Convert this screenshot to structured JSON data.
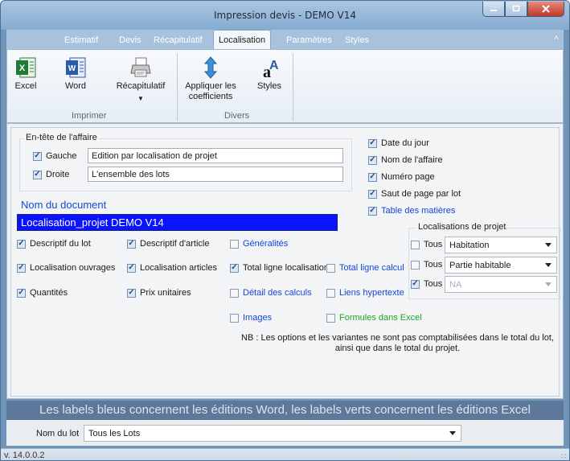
{
  "window": {
    "title": "Impression devis  - DEMO V14",
    "controls": {
      "minimize_icon": "minimize-icon",
      "maximize_icon": "maximize-icon",
      "close_icon": "close-icon"
    }
  },
  "tabs": [
    {
      "label": "Estimatif"
    },
    {
      "label": "Devis"
    },
    {
      "label": "Récapitulatif"
    },
    {
      "label": "Localisation",
      "active": true
    },
    {
      "label": "Paramètres"
    },
    {
      "label": "Styles"
    }
  ],
  "ribbon": {
    "excel_label": "Excel",
    "word_label": "Word",
    "recap_label": "Récapitulatif",
    "appliquer_label_1": "Appliquer les",
    "appliquer_label_2": "coefficients",
    "styles_label": "Styles",
    "group_imprimer": "Imprimer",
    "group_divers": "Divers"
  },
  "entete": {
    "title": "En-tête de l'affaire",
    "gauche_label": "Gauche",
    "gauche_checked": true,
    "gauche_value": "Edition par localisation de projet",
    "droite_label": "Droite",
    "droite_checked": true,
    "droite_value": "L'ensemble des lots"
  },
  "right_options": [
    {
      "label": "Date du jour",
      "checked": true
    },
    {
      "label": "Nom de l'affaire",
      "checked": true
    },
    {
      "label": "Numéro page",
      "checked": true
    },
    {
      "label": "Saut de page par lot",
      "checked": true
    },
    {
      "label": "Table des matières",
      "checked": true,
      "color": "blue"
    }
  ],
  "document": {
    "label": "Nom du document",
    "value": "Localisation_projet DEMO V14"
  },
  "options": {
    "descriptif_lot": "Descriptif du lot",
    "localisation_ouvrages": "Localisation ouvrages",
    "quantites": "Quantités",
    "descriptif_article": "Descriptif d'article",
    "localisation_articles": "Localisation articles",
    "prix_unitaires": "Prix unitaires",
    "generalites": "Généralités",
    "total_ligne_localisation": "Total ligne localisation",
    "total_ligne_calcul": "Total ligne calcul",
    "detail_calculs": "Détail des calculs",
    "liens_hypertexte": "Liens hypertexte",
    "images": "Images",
    "formules_excel": "Formules dans Excel"
  },
  "localisations": {
    "title": "Localisations de projet",
    "rows": [
      {
        "tous_label": "Tous",
        "checked": false,
        "value": "Habitation",
        "disabled": false
      },
      {
        "tous_label": "Tous",
        "checked": false,
        "value": "Partie habitable",
        "disabled": false
      },
      {
        "tous_label": "Tous",
        "checked": true,
        "value": "NA",
        "disabled": true
      }
    ]
  },
  "note": {
    "line1": "NB : Les options et les variantes ne sont pas comptabilisées dans le total du lot,",
    "line2": "ainsi que dans le total du projet."
  },
  "footer": {
    "banner": "Les labels bleus concernent les éditions Word, les labels verts concernent les éditions Excel",
    "lot_label": "Nom du lot",
    "lot_value": "Tous les Lots"
  },
  "status": {
    "version": "v. 14.0.0.2"
  },
  "colors": {
    "word_label_color": "#1646d8",
    "excel_label_color": "#1fa52a",
    "document_field_bg": "#0a14ff"
  }
}
